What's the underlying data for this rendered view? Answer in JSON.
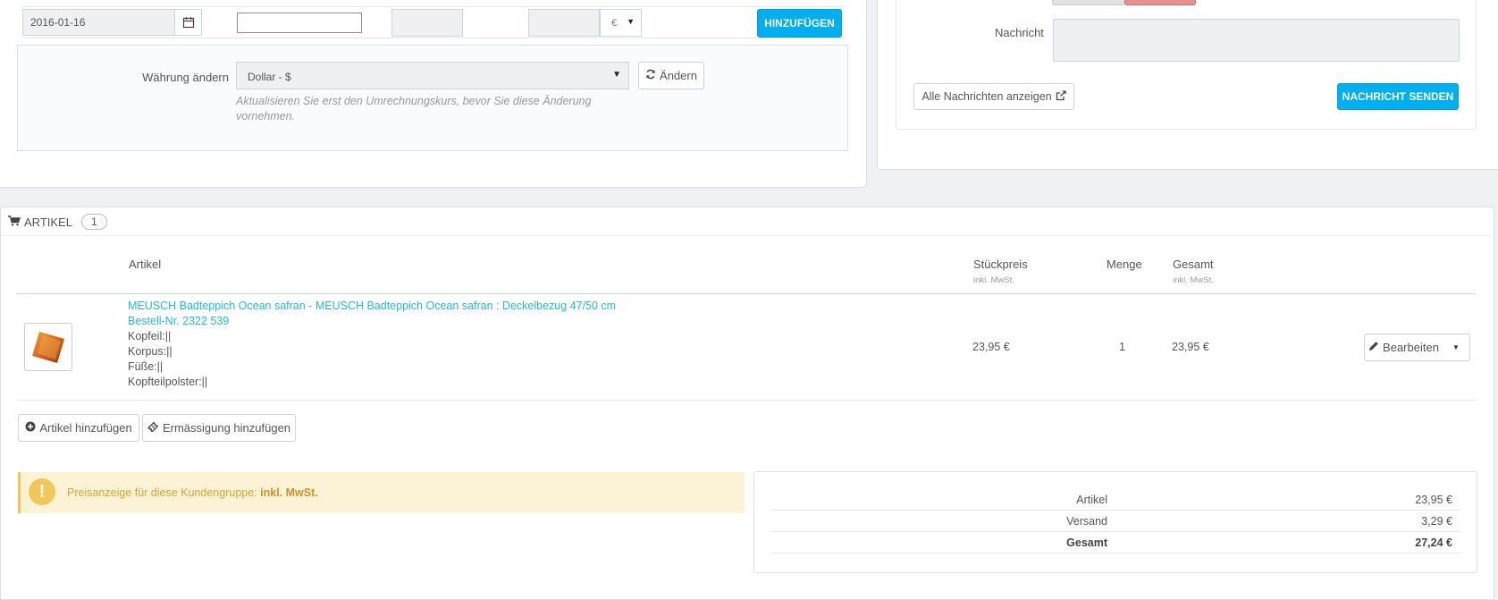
{
  "payment_row": {
    "date_value": "2016-01-16",
    "currency_symbol": "€",
    "add_button": "HINZUFÜGEN"
  },
  "currency_change": {
    "label": "Währung ändern",
    "selected": "Dollar - $",
    "button": "Ändern",
    "help": "Aktualisieren Sie erst den Umrechnungskurs, bevor Sie diese Änderung vornehmen."
  },
  "messages": {
    "label": "Nachricht",
    "show_all_button": "Alle Nachrichten anzeigen",
    "send_button": "NACHRICHT SENDEN"
  },
  "articles": {
    "title": "ARTIKEL",
    "count": "1",
    "columns": {
      "product": "Artikel",
      "unit_price": "Stückpreis",
      "unit_price_sub": "inkl. MwSt.",
      "qty": "Menge",
      "total": "Gesamt",
      "total_sub": "inkl. MwSt."
    },
    "rows": [
      {
        "name": "MEUSCH Badteppich Ocean safran - MEUSCH Badteppich Ocean safran : Deckelbezug 47/50 cm",
        "ref": "Bestell-Nr. 2322 539",
        "attr1": "Kopfeil:||",
        "attr2": "Korpus:||",
        "attr3": "Füße:||",
        "attr4": "Kopfteilpolster:||",
        "unit_price": "23,95 €",
        "qty": "1",
        "total": "23,95 €",
        "edit_button": "Bearbeiten"
      }
    ],
    "add_product_button": "Artikel hinzufügen",
    "add_discount_button": "Ermässigung hinzufügen"
  },
  "alert": {
    "text": "Preisanzeige für diese Kundengruppe:",
    "strong": "inkl. MwSt."
  },
  "totals": {
    "products_label": "Artikel",
    "products_value": "23,95 €",
    "shipping_label": "Versand",
    "shipping_value": "3,29 €",
    "total_label": "Gesamt",
    "total_value": "27,24 €"
  },
  "colors": {
    "primary": "#00aff0",
    "link": "#25b9d7",
    "warning_bg": "#fcf2d6",
    "warning_icon": "#f1c65b"
  }
}
